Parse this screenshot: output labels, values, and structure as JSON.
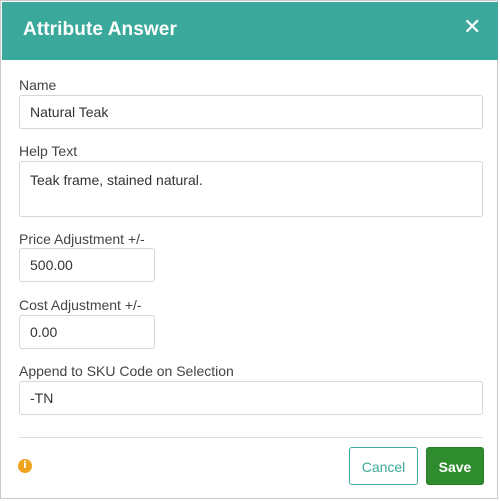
{
  "dialog": {
    "title": "Attribute Answer",
    "close_glyph": "✕"
  },
  "form": {
    "name": {
      "label": "Name",
      "value": "Natural Teak"
    },
    "help_text": {
      "label": "Help Text",
      "value": "Teak frame, stained natural."
    },
    "price_adjustment": {
      "label": "Price Adjustment +/-",
      "value": "500.00"
    },
    "cost_adjustment": {
      "label": "Cost Adjustment +/-",
      "value": "0.00"
    },
    "sku_append": {
      "label": "Append to SKU Code on Selection",
      "value": "-TN"
    }
  },
  "footer": {
    "info_icon": "info-icon",
    "info_glyph": "i",
    "cancel_label": "Cancel",
    "save_label": "Save"
  },
  "colors": {
    "header": "#3aa99b",
    "save": "#2e8b2e",
    "info": "#f0a41e"
  }
}
